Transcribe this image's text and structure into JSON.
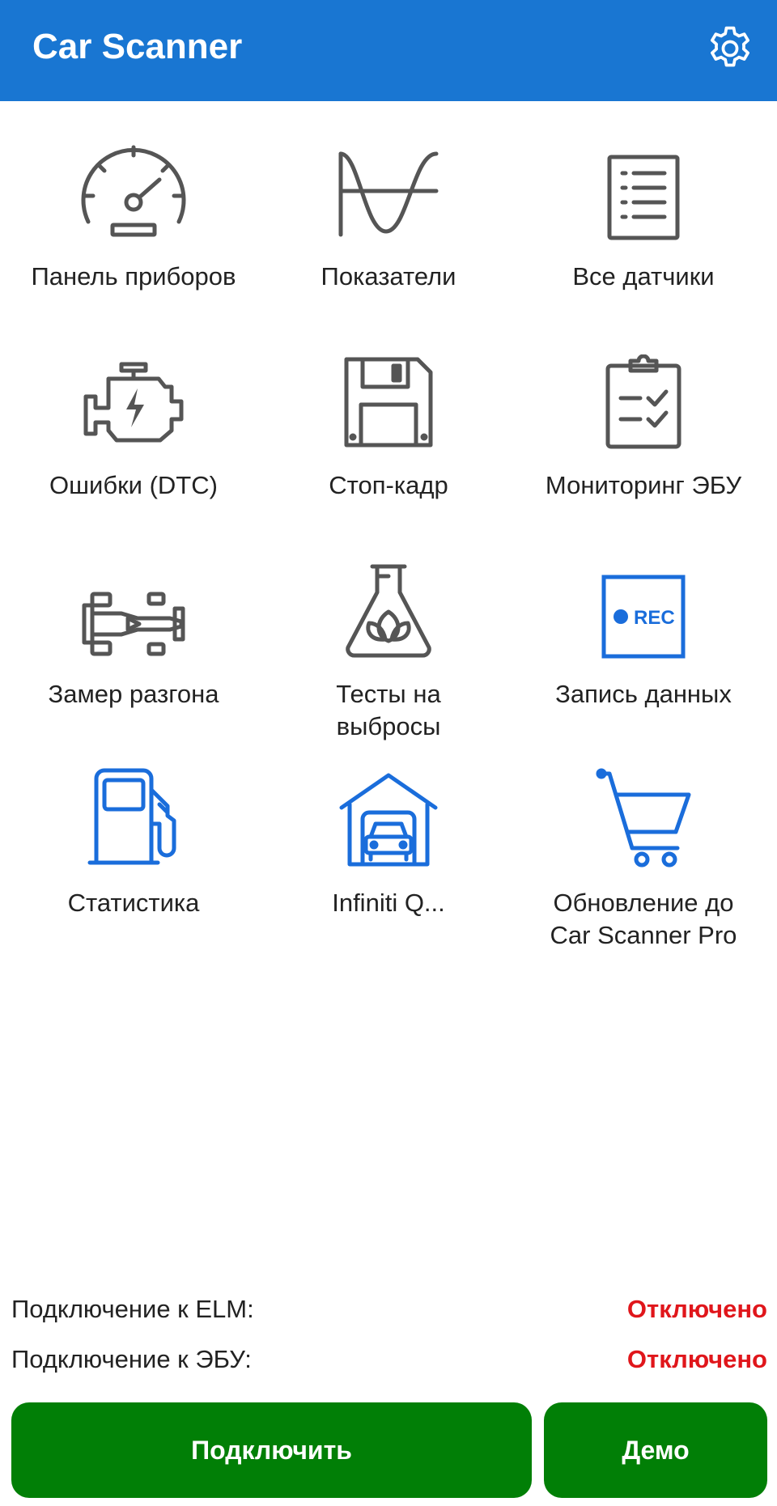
{
  "app_bar": {
    "title": "Car Scanner",
    "background": "#1976d2",
    "settings_icon": "gear-icon"
  },
  "tiles": [
    {
      "label": "Панель приборов",
      "icon": "speedometer-icon",
      "color": "#555555"
    },
    {
      "label": "Показатели",
      "icon": "sine-wave-icon",
      "color": "#555555"
    },
    {
      "label": "Все датчики",
      "icon": "list-document-icon",
      "color": "#555555"
    },
    {
      "label": "Ошибки (DTC)",
      "icon": "engine-icon",
      "color": "#555555"
    },
    {
      "label": "Стоп-кадр",
      "icon": "floppy-disk-icon",
      "color": "#555555"
    },
    {
      "label": "Мониторинг ЭБУ",
      "icon": "clipboard-check-icon",
      "color": "#555555"
    },
    {
      "label": "Замер разгона",
      "icon": "race-car-icon",
      "color": "#555555"
    },
    {
      "label": "Тесты на\nвыбросы",
      "icon": "flask-leaf-icon",
      "color": "#555555"
    },
    {
      "label": "Запись данных",
      "icon": "rec-icon",
      "color": "#1a6ddb"
    },
    {
      "label": "Статистика",
      "icon": "fuel-pump-icon",
      "color": "#1a6ddb"
    },
    {
      "label": "Infiniti Q...",
      "icon": "garage-car-icon",
      "color": "#1a6ddb"
    },
    {
      "label": "Обновление до\nCar Scanner Pro",
      "icon": "shopping-cart-icon",
      "color": "#1a6ddb"
    }
  ],
  "rec_text": "REC",
  "status": {
    "elm_label": "Подключение к ELM:",
    "elm_value": "Отключено",
    "ecu_label": "Подключение к ЭБУ:",
    "ecu_value": "Отключено",
    "status_color": "#e0161b"
  },
  "buttons": {
    "connect_label": "Подключить",
    "demo_label": "Демо",
    "color": "#017f06"
  }
}
